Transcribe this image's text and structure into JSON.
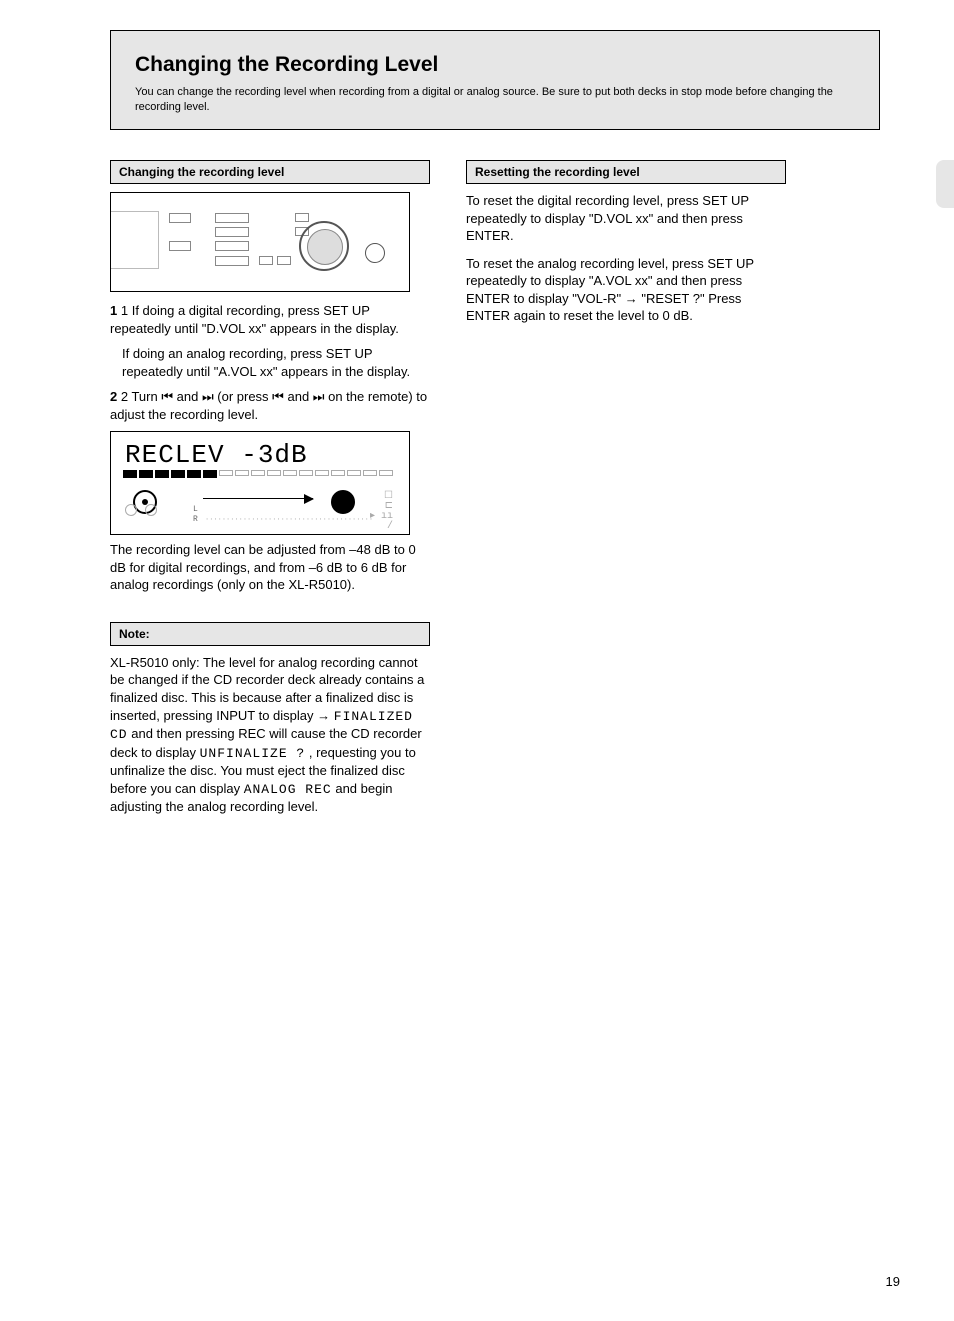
{
  "topbox": {
    "title": "Changing the Recording Level",
    "subtitle": "You can change the recording level when recording from a digital or analog source. Be sure to put both decks in stop mode before changing the recording level."
  },
  "left": {
    "hdr1": "Changing the recording level",
    "steps1": {
      "s1a": "1 If doing a digital recording, press SET UP repeatedly until \"D.VOL xx\" appears in the display.",
      "s1b": "If doing an analog recording, press SET UP repeatedly until \"A.VOL xx\" appears in the display.",
      "s2": "2 Turn ",
      "s2mid": " (or press ",
      "s2end": " on the remote) to adjust the recording level."
    },
    "lcd_main": "RECLEV   -3dB",
    "note1": "The recording level can be adjusted from –48 dB to 0 dB for digital recordings, and from –6 dB to 6 dB for analog recordings (only on the XL-R5010).",
    "hdr2": "Note:",
    "note2a": "XL-R5010 only: The level for analog recording cannot be changed if the CD recorder deck already contains a finalized disc. This is because after a finalized disc is inserted, pressing INPUT to display ",
    "note2b": " and then pressing REC will cause the CD recorder deck to display ",
    "note2c": ", requesting you to unfinalize the disc. You must eject the finalized disc before you can display ",
    "note2d": " and begin adjusting the analog recording level.",
    "lcd_small1": "FINALIZED CD",
    "lcd_small2": "UNFINALIZE ?",
    "lcd_small3": "ANALOG REC"
  },
  "right": {
    "hdr": "Resetting the recording level",
    "p1": "To reset the digital recording level, press SET UP repeatedly to display \"D.VOL xx\" and then press ENTER.",
    "p2": "To reset the analog recording level, press SET UP repeatedly to display \"A.VOL xx\" and then press ENTER to display \"VOL-R\" ",
    "p2end": " \"RESET ?\" Press ENTER again to reset the level to 0 dB."
  },
  "page": "19",
  "icons": {
    "prev": "⏮",
    "next": "⏭",
    "arrow": "→"
  }
}
